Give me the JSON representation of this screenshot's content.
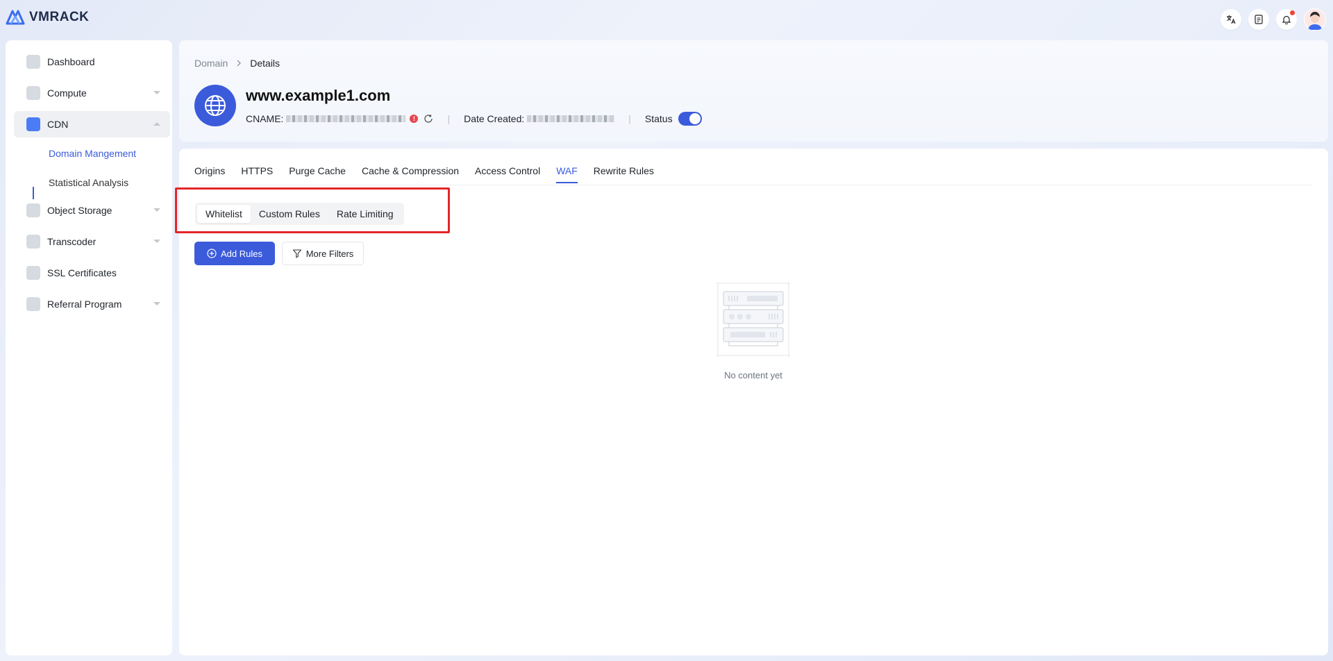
{
  "app": {
    "brand": "VMRACK"
  },
  "sidebar": {
    "items": [
      {
        "label": "Dashboard"
      },
      {
        "label": "Compute"
      },
      {
        "label": "CDN"
      },
      {
        "label": "Object Storage"
      },
      {
        "label": "Transcoder"
      },
      {
        "label": "SSL Certificates"
      },
      {
        "label": "Referral Program"
      }
    ],
    "cdn_sub": [
      {
        "label": "Domain Mangement"
      },
      {
        "label": "Statistical Analysis"
      }
    ]
  },
  "breadcrumb": {
    "parent": "Domain",
    "current": "Details"
  },
  "domain": {
    "name": "www.example1.com",
    "cname_label": "CNAME:",
    "date_label": "Date Created:",
    "status_label": "Status",
    "status_on": true,
    "error_glyph": "!"
  },
  "tabs": [
    {
      "label": "Origins"
    },
    {
      "label": "HTTPS"
    },
    {
      "label": "Purge Cache"
    },
    {
      "label": "Cache & Compression"
    },
    {
      "label": "Access Control"
    },
    {
      "label": "WAF"
    },
    {
      "label": "Rewrite Rules"
    }
  ],
  "waf_segments": [
    {
      "label": "Whitelist"
    },
    {
      "label": "Custom Rules"
    },
    {
      "label": "Rate Limiting"
    }
  ],
  "actions": {
    "add_rules": "Add Rules",
    "more_filters": "More Filters"
  },
  "empty": {
    "text": "No content yet"
  },
  "colors": {
    "accent": "#3b5bdb",
    "highlight": "#e3262a",
    "notification": "#f04438"
  },
  "icons": [
    "logo-icon",
    "translate-icon",
    "document-icon",
    "bell-icon",
    "user-avatar-icon",
    "globe-icon",
    "refresh-icon",
    "filter-icon",
    "plus-circle-icon",
    "server-empty-icon"
  ]
}
